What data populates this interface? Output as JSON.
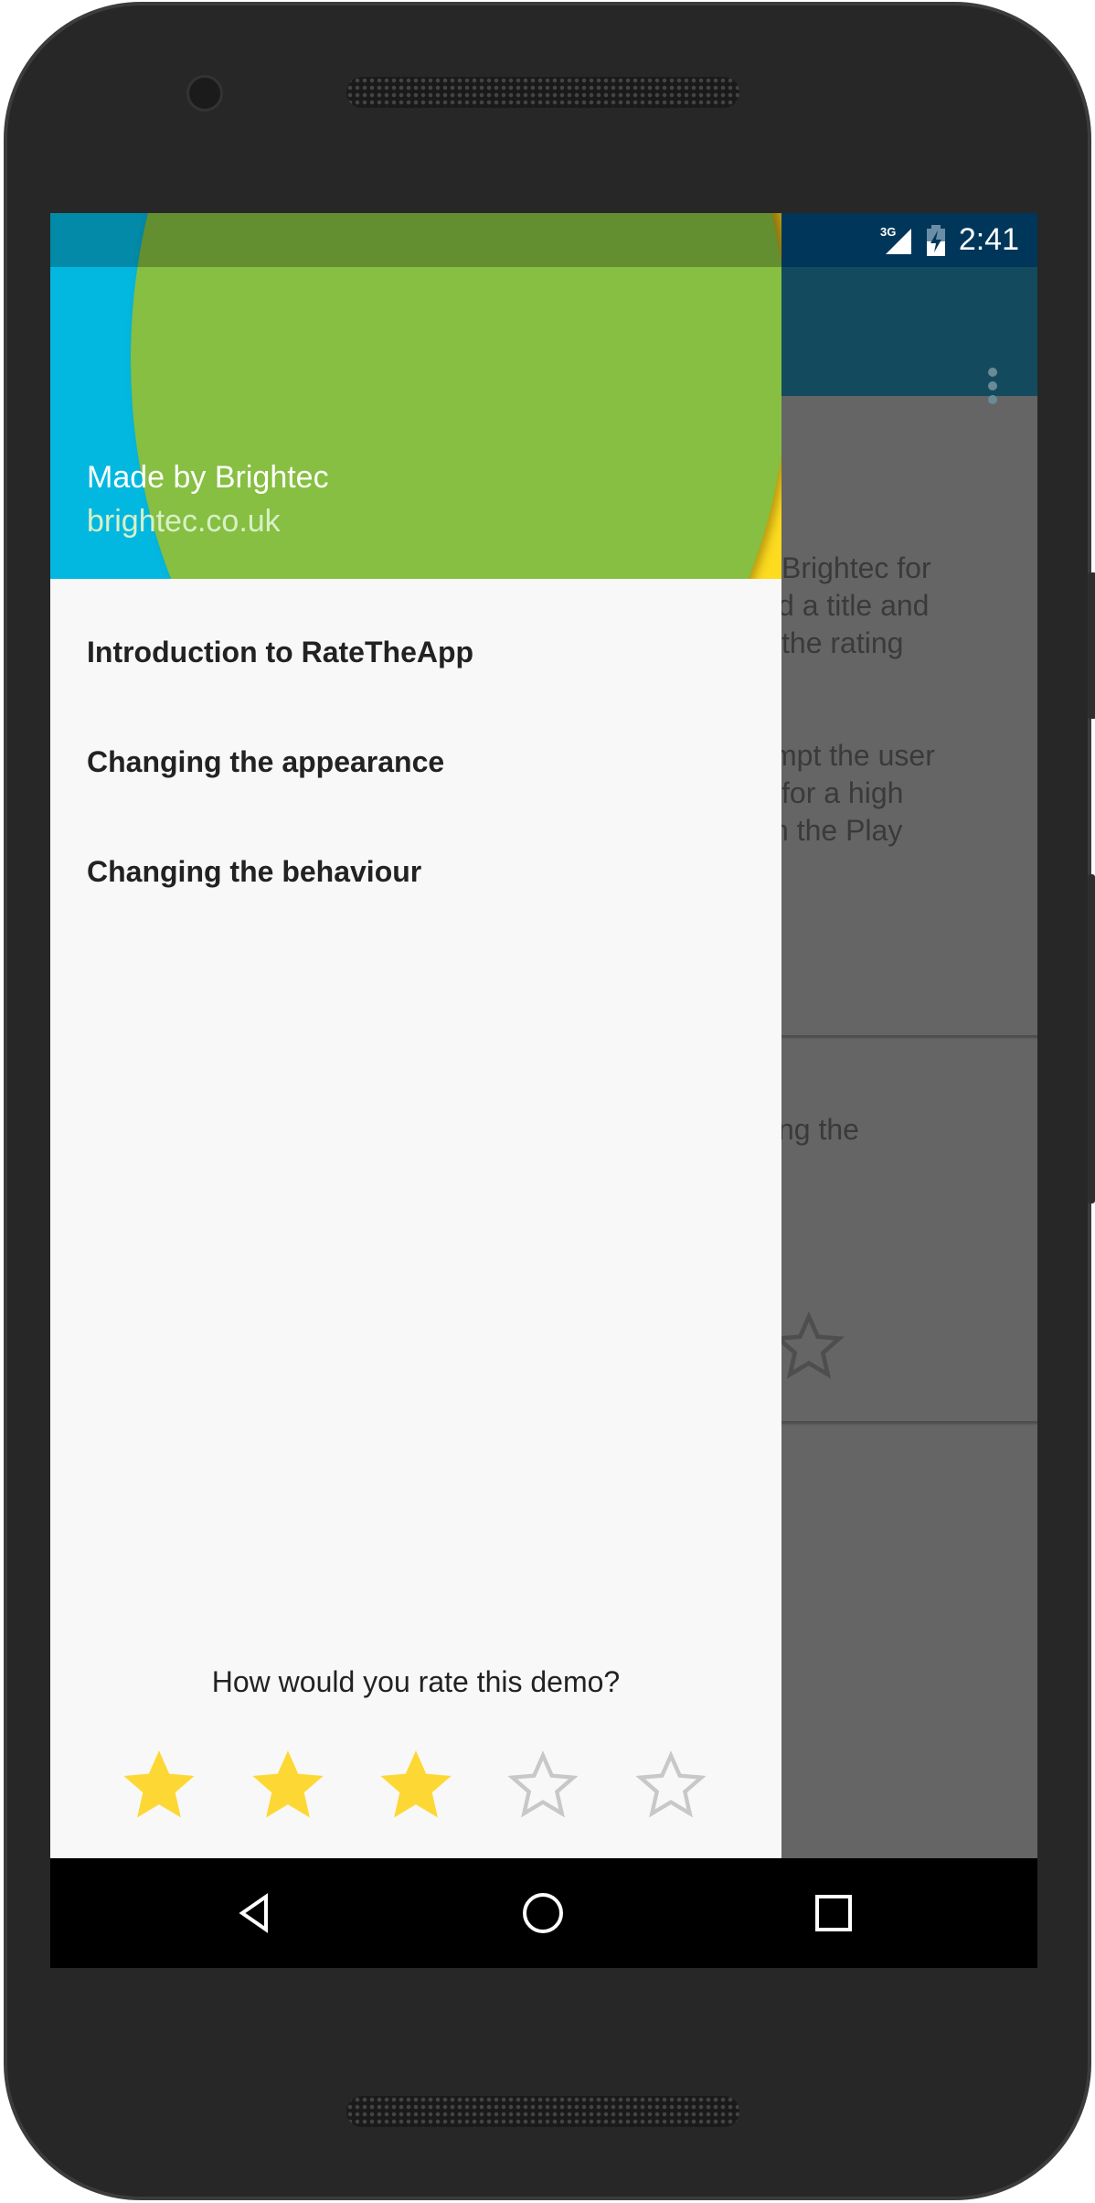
{
  "status_bar": {
    "network": "3G",
    "time": "2:41"
  },
  "drawer": {
    "header": {
      "title": "Made by Brightec",
      "subtitle": "brightec.co.uk"
    },
    "menu_items": [
      {
        "label": "Introduction to RateTheApp"
      },
      {
        "label": "Changing the appearance"
      },
      {
        "label": "Changing the behaviour"
      }
    ],
    "rating": {
      "question": "How would you rate this demo?",
      "value": 3,
      "max": 5,
      "filled_color": "#fdd835",
      "empty_color": "#c8c8c8"
    }
  },
  "background_content": {
    "card1_lines": [
      "Brightec for",
      "d a title and",
      "the rating",
      "mpt the user",
      "for a high",
      "n the Play"
    ],
    "card2_lines": [
      "ng the"
    ]
  },
  "colors": {
    "header_blue": "#03b8e0",
    "header_green": "#86bf41",
    "header_yellow": "#fddb1f",
    "status_bar": "#00365a",
    "toolbar": "#144a5e"
  }
}
